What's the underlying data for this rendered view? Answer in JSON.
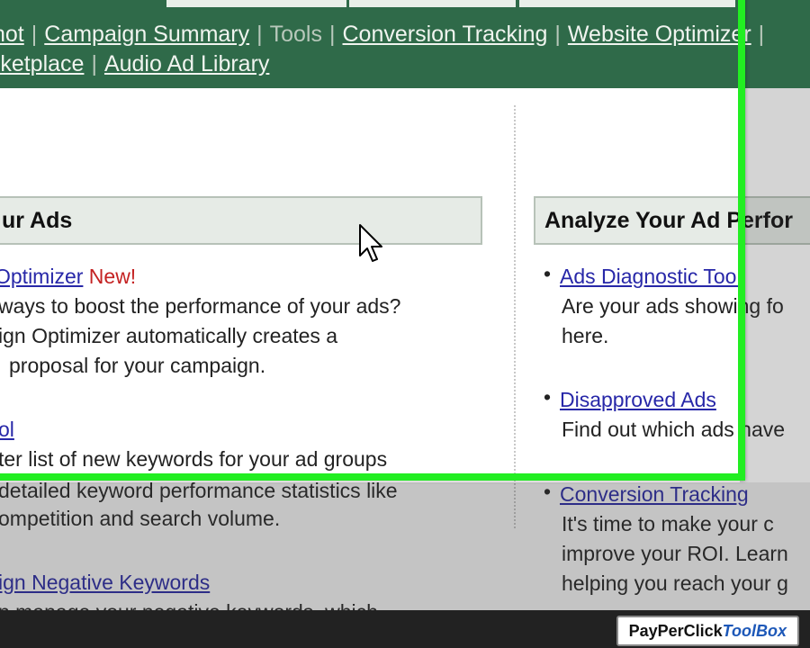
{
  "nav": {
    "row1": [
      {
        "label": "hot",
        "current": false
      },
      {
        "label": "Campaign Summary",
        "current": false
      },
      {
        "label": "Tools",
        "current": true
      },
      {
        "label": "Conversion Tracking",
        "current": false
      },
      {
        "label": "Website Optimizer",
        "current": false
      }
    ],
    "row2": [
      {
        "label": "rketplace",
        "current": false
      },
      {
        "label": "Audio Ad Library",
        "current": false
      }
    ]
  },
  "left": {
    "header": "ur Ads",
    "optimizer_link": "Optimizer",
    "new_badge": "New!",
    "optimizer_desc": [
      "ways to boost the performance of your ads?",
      "ign Optimizer automatically creates a",
      "proposal for your campaign."
    ],
    "tool_link": "ol",
    "tool_desc": [
      "ter list of new keywords for your ad groups",
      "detailed keyword performance statistics like",
      "ompetition and search volume."
    ],
    "negative_link": "ign Negative Keywords",
    "negative_desc": "n manage your negative keywords, which"
  },
  "right": {
    "header": "Analyze Your Ad Perfor",
    "items": [
      {
        "link": "Ads Diagnostic Tool",
        "desc": [
          "Are your ads showing fo",
          "here."
        ]
      },
      {
        "link": "Disapproved Ads",
        "desc": [
          "Find out which ads have"
        ]
      },
      {
        "link": "Conversion Tracking",
        "desc": [
          "It's time to make your c",
          "improve your ROI. Learn",
          "helping you reach your g"
        ]
      }
    ]
  },
  "branding": {
    "part1": "PayPerClick",
    "part2": "ToolBox"
  },
  "colors": {
    "nav_bg": "#2f6a49",
    "highlight_frame": "#22ee22",
    "link": "#2727a8",
    "new": "#c42222"
  }
}
